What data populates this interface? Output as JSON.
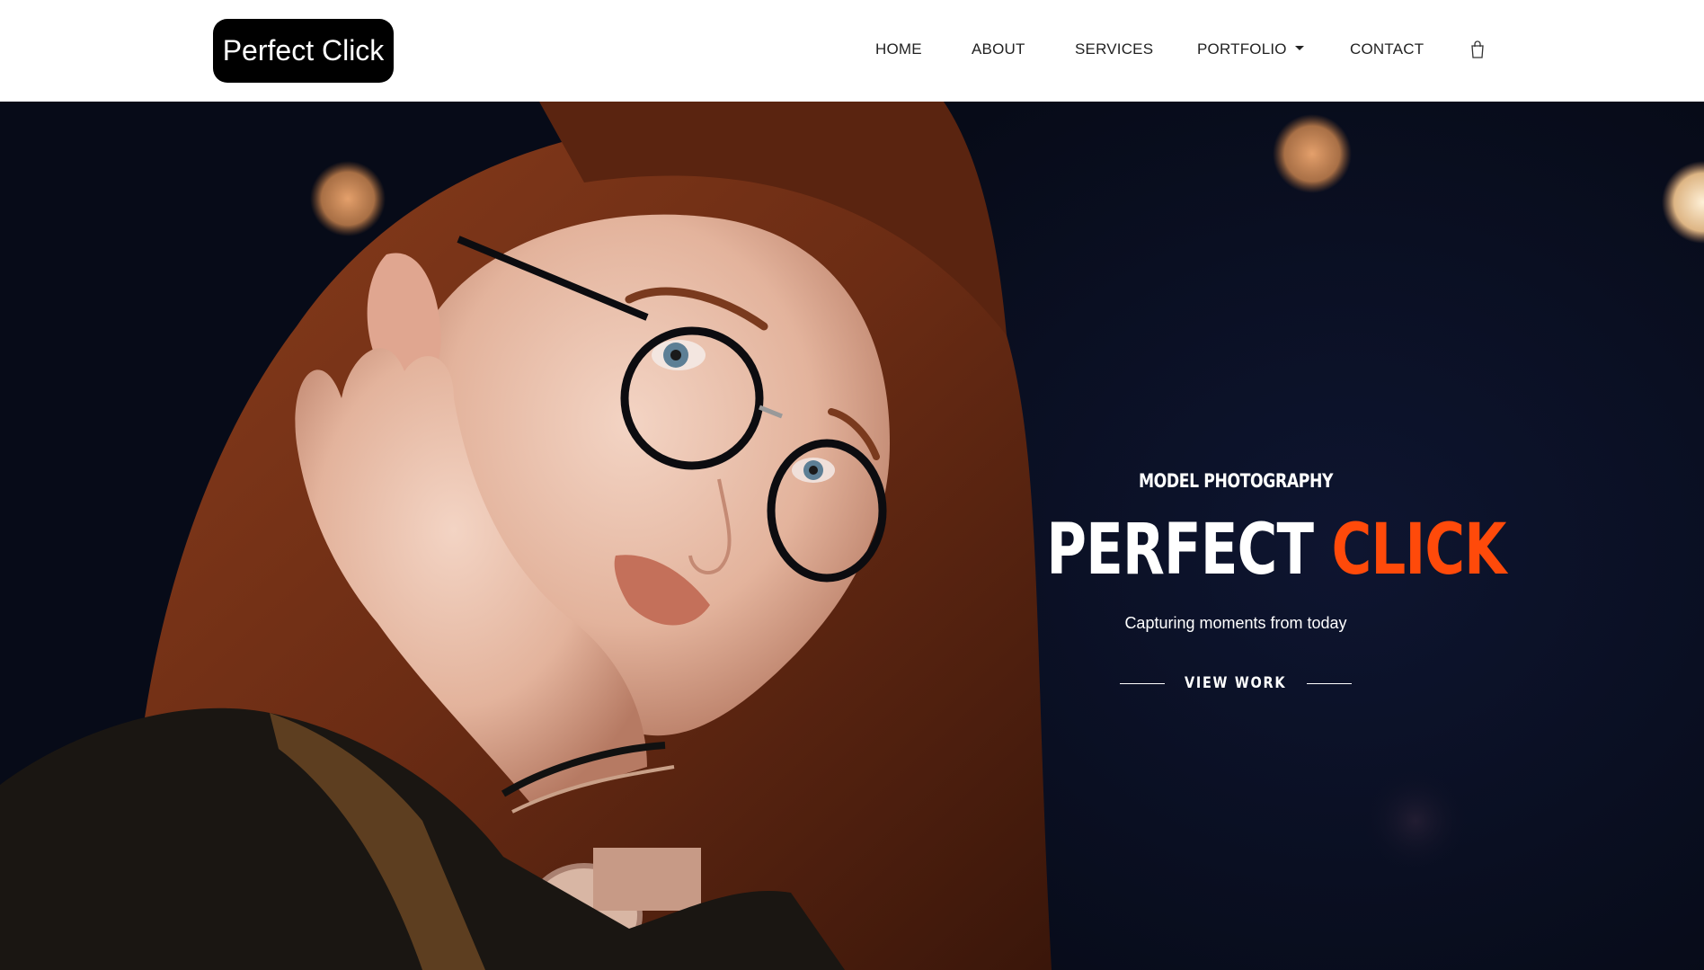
{
  "brand": {
    "logo_text": "Perfect Click"
  },
  "nav": {
    "items": [
      {
        "label": "HOME"
      },
      {
        "label": "ABOUT"
      },
      {
        "label": "SERVICES"
      },
      {
        "label": "PORTFOLIO",
        "has_dropdown": true
      },
      {
        "label": "CONTACT"
      }
    ],
    "cart_icon": "shopping-bag-icon"
  },
  "hero": {
    "eyebrow": "MODEL PHOTOGRAPHY",
    "headline_part1": "PERFECT",
    "headline_part2": "CLICK",
    "tagline": "Capturing moments from today",
    "cta_label": "VIEW WORK"
  },
  "colors": {
    "accent": "#ff4a0a",
    "header_bg": "#ffffff",
    "hero_bg": "#0a0f22",
    "logo_bg": "#000000"
  }
}
